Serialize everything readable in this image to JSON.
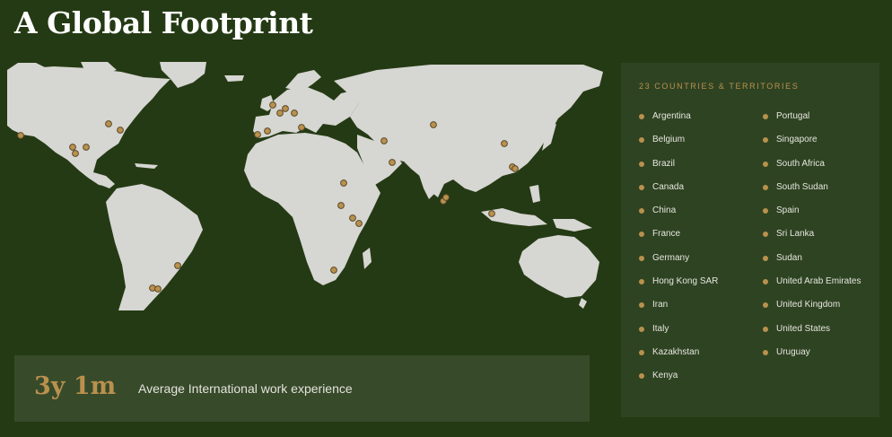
{
  "title": "A Global Footprint",
  "colors": {
    "background": "#243a14",
    "land": "#d6d6d2",
    "accent": "#b9914d",
    "panel": "#2e4322",
    "stat_box": "#374a2a"
  },
  "panel": {
    "heading": "23 COUNTRIES & TERRITORIES",
    "column1": [
      "Argentina",
      "Belgium",
      "Brazil",
      "Canada",
      "China",
      "France",
      "Germany",
      "Hong Kong SAR",
      "Iran",
      "Italy",
      "Kazakhstan",
      "Kenya"
    ],
    "column2": [
      "Portugal",
      "Singapore",
      "South Africa",
      "South Sudan",
      "Spain",
      "Sri Lanka",
      "Sudan",
      "United Arab Emirates",
      "United Kingdom",
      "United States",
      "Uruguay"
    ]
  },
  "stat": {
    "value": "3y 1m",
    "label": "Average International work experience"
  }
}
